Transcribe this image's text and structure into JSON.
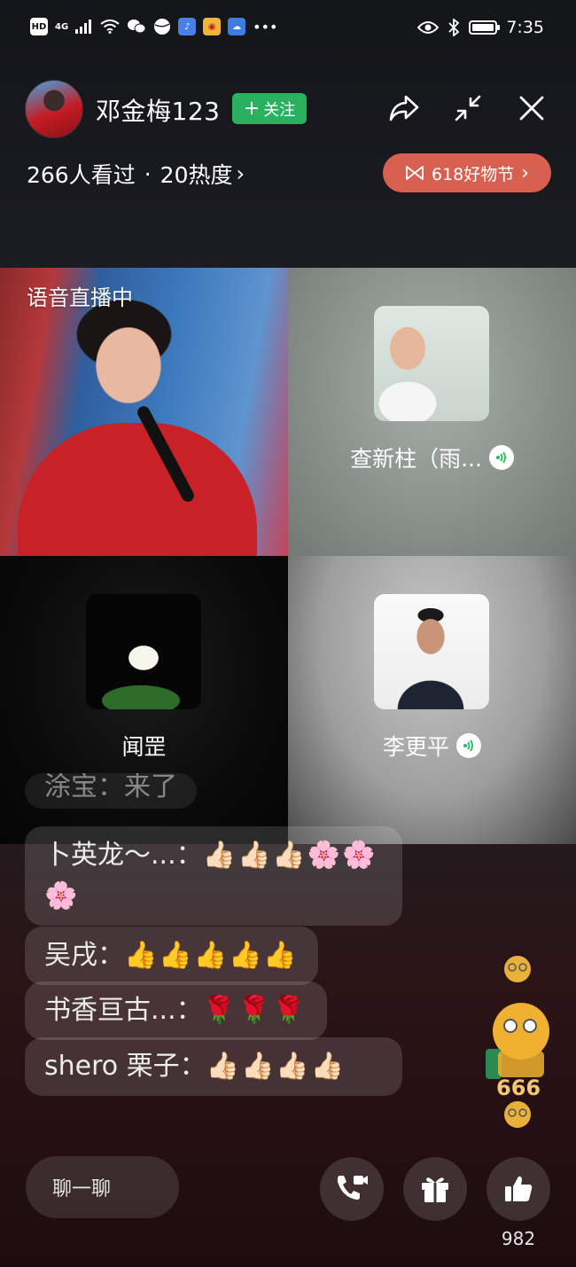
{
  "status_bar": {
    "time": "7:35",
    "network_badges": [
      "HD",
      "4G"
    ]
  },
  "header": {
    "host_name": "邓金梅123",
    "follow_label": "关注",
    "viewers_text": "266人看过",
    "separator": "·",
    "heat_text": "20热度",
    "promo_label": "618好物节"
  },
  "stage": {
    "host_tile_label": "语音直播中",
    "guests": [
      {
        "name": "查新柱（雨...",
        "speaking": true
      },
      {
        "name": "闻罡",
        "speaking": false
      },
      {
        "name": "李更平",
        "speaking": true
      }
    ]
  },
  "comments": [
    {
      "user": "涂宝",
      "text": "来了",
      "partial": true
    },
    {
      "user": "卜英龙～...",
      "text": "👍🏻👍🏻👍🏻🌸🌸🌸"
    },
    {
      "user": "吴戌",
      "text": "👍👍👍👍👍"
    },
    {
      "user": "书香亘古...",
      "text": "🌹🌹🌹"
    },
    {
      "user": "shero 栗子",
      "text": "👍🏻👍🏻👍🏻👍🏻"
    }
  ],
  "floating_emoji": {
    "badge_text": "666"
  },
  "bottom_bar": {
    "chat_placeholder": "聊一聊",
    "like_count": "982"
  },
  "colors": {
    "follow_green": "#29b160",
    "promo_orange": "#d86050",
    "speaking_green": "#1fbf5c"
  }
}
